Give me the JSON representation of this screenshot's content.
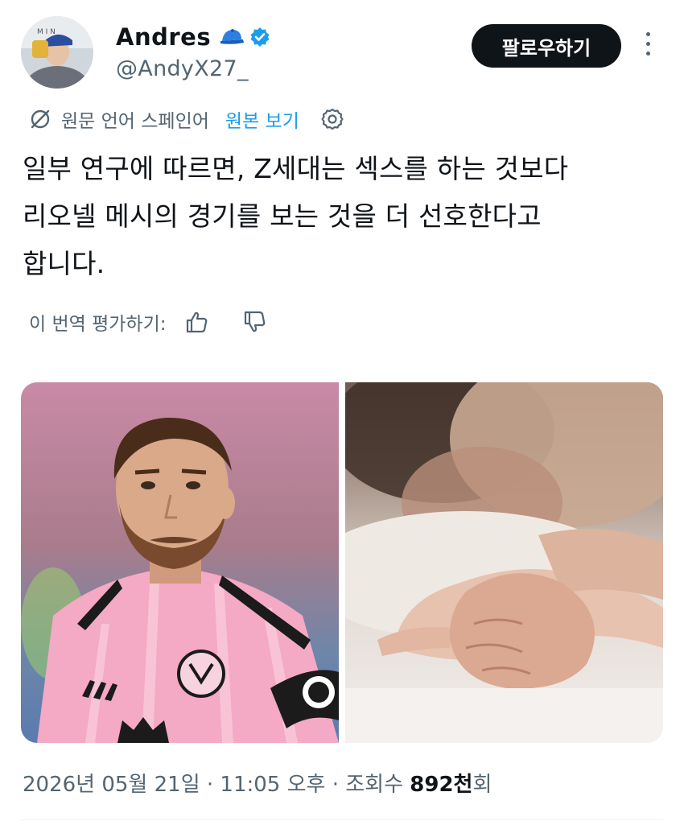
{
  "author": {
    "display_name": "Andres",
    "handle": "@AndyX27_",
    "emoji_icon": "blue-cap-icon",
    "verified_icon": "verified-badge-icon",
    "accent_color": "#1d9bf0"
  },
  "follow_button": {
    "label": "팔로우하기"
  },
  "translation": {
    "source_language": "원문 언어 스페인어",
    "view_original": "원본 보기"
  },
  "tweet": {
    "lines": [
      "일부 연구에 따르면, Z세대는 섹스를 하는 것보다",
      "리오넬 메시의 경기를 보는 것을 더 선호한다고",
      "합니다."
    ]
  },
  "rate_translation": {
    "label": "이 번역 평가하기:"
  },
  "media": [
    {
      "kind": "photo",
      "subject": "soccer player in pink jersey"
    },
    {
      "kind": "photo",
      "subject": "two hands clasped on white bed sheet"
    }
  ],
  "meta": {
    "date_time": "2026년 05월 21일 · 11:05 오후 · 조회수 ",
    "views_count": "892천",
    "views_suffix": "회"
  }
}
